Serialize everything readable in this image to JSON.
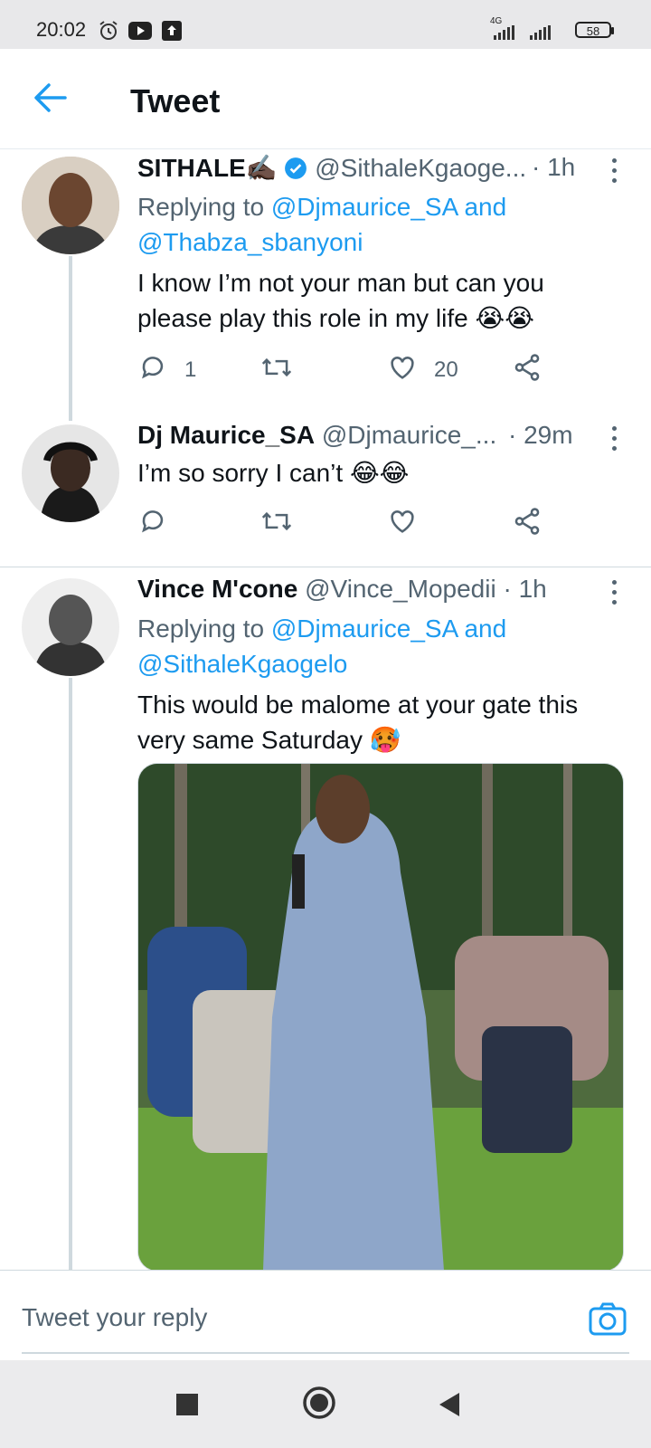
{
  "status_bar": {
    "time": "20:02",
    "network": "4G",
    "battery": "58"
  },
  "header": {
    "title": "Tweet"
  },
  "tweets": [
    {
      "name": "SITHALE✍🏿",
      "verified": true,
      "handle": "@SithaleKgaoge...",
      "time": "· 1h",
      "replying_prefix": "Replying to",
      "replying_to": "@Djmaurice_SA and",
      "replying_to_2": "@Thabza_sbanyoni",
      "text_line1": "I know I’m not your man but can you",
      "text_line2": "please play this role in my life 😭😭",
      "replies": "1",
      "retweets": "",
      "likes": "20"
    },
    {
      "name": "Dj Maurice_SA",
      "handle": "@Djmaurice_...",
      "time": "· 29m",
      "text_line1": "I’m so sorry I can’t 😂😂",
      "replies": "",
      "retweets": "",
      "likes": ""
    },
    {
      "name": "Vince M'cone",
      "handle": "@Vince_Mopedii",
      "time": "· 1h",
      "replying_prefix": "Replying to",
      "replying_to": "@Djmaurice_SA and",
      "replying_to_2": "@SithaleKgaogelo",
      "text_line1": "This would be malome at your gate this",
      "text_line2": "very same Saturday 🥵"
    }
  ],
  "reply_bar": {
    "placeholder": "Tweet your reply"
  },
  "colors": {
    "accent": "#1d9bf0",
    "secondary_text": "#536471",
    "divider": "#cfd9de"
  },
  "icons": [
    "alarm-icon",
    "youtube-icon",
    "upload-icon",
    "signal-icon",
    "back-arrow-icon",
    "verified-icon",
    "more-icon",
    "reply-icon",
    "retweet-icon",
    "like-icon",
    "share-icon",
    "camera-icon",
    "recents-icon",
    "home-icon",
    "back-icon"
  ]
}
